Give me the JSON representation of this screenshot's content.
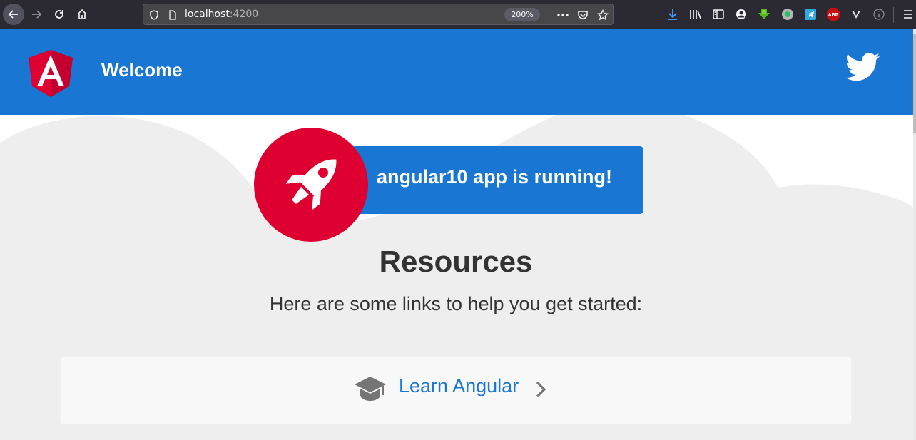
{
  "browser": {
    "url_host": "localhost",
    "url_port": ":4200",
    "zoom": "200%",
    "ext_abp": "ABP"
  },
  "app": {
    "toolbar_title": "Welcome",
    "banner_text": "angular10 app is running!",
    "resources_heading": "Resources",
    "resources_subtitle": "Here are some links to help you get started:",
    "link_learn": "Learn Angular"
  },
  "colors": {
    "toolbar": "#1976d2",
    "angular_red": "#dd0031",
    "cloud": "#eeeeee"
  },
  "icons": [
    "back-arrow-icon",
    "forward-arrow-icon",
    "reload-icon",
    "home-icon",
    "shield-icon",
    "page-icon",
    "more-icon",
    "pocket-icon",
    "star-icon",
    "download-icon",
    "library-icon",
    "sidebar-icon",
    "account-icon",
    "extension-icon",
    "telegram-icon",
    "abp-icon",
    "vimium-icon",
    "info-icon",
    "menu-icon",
    "angular-logo-icon",
    "twitter-icon",
    "rocket-icon",
    "graduation-cap-icon",
    "chevron-right-icon"
  ]
}
